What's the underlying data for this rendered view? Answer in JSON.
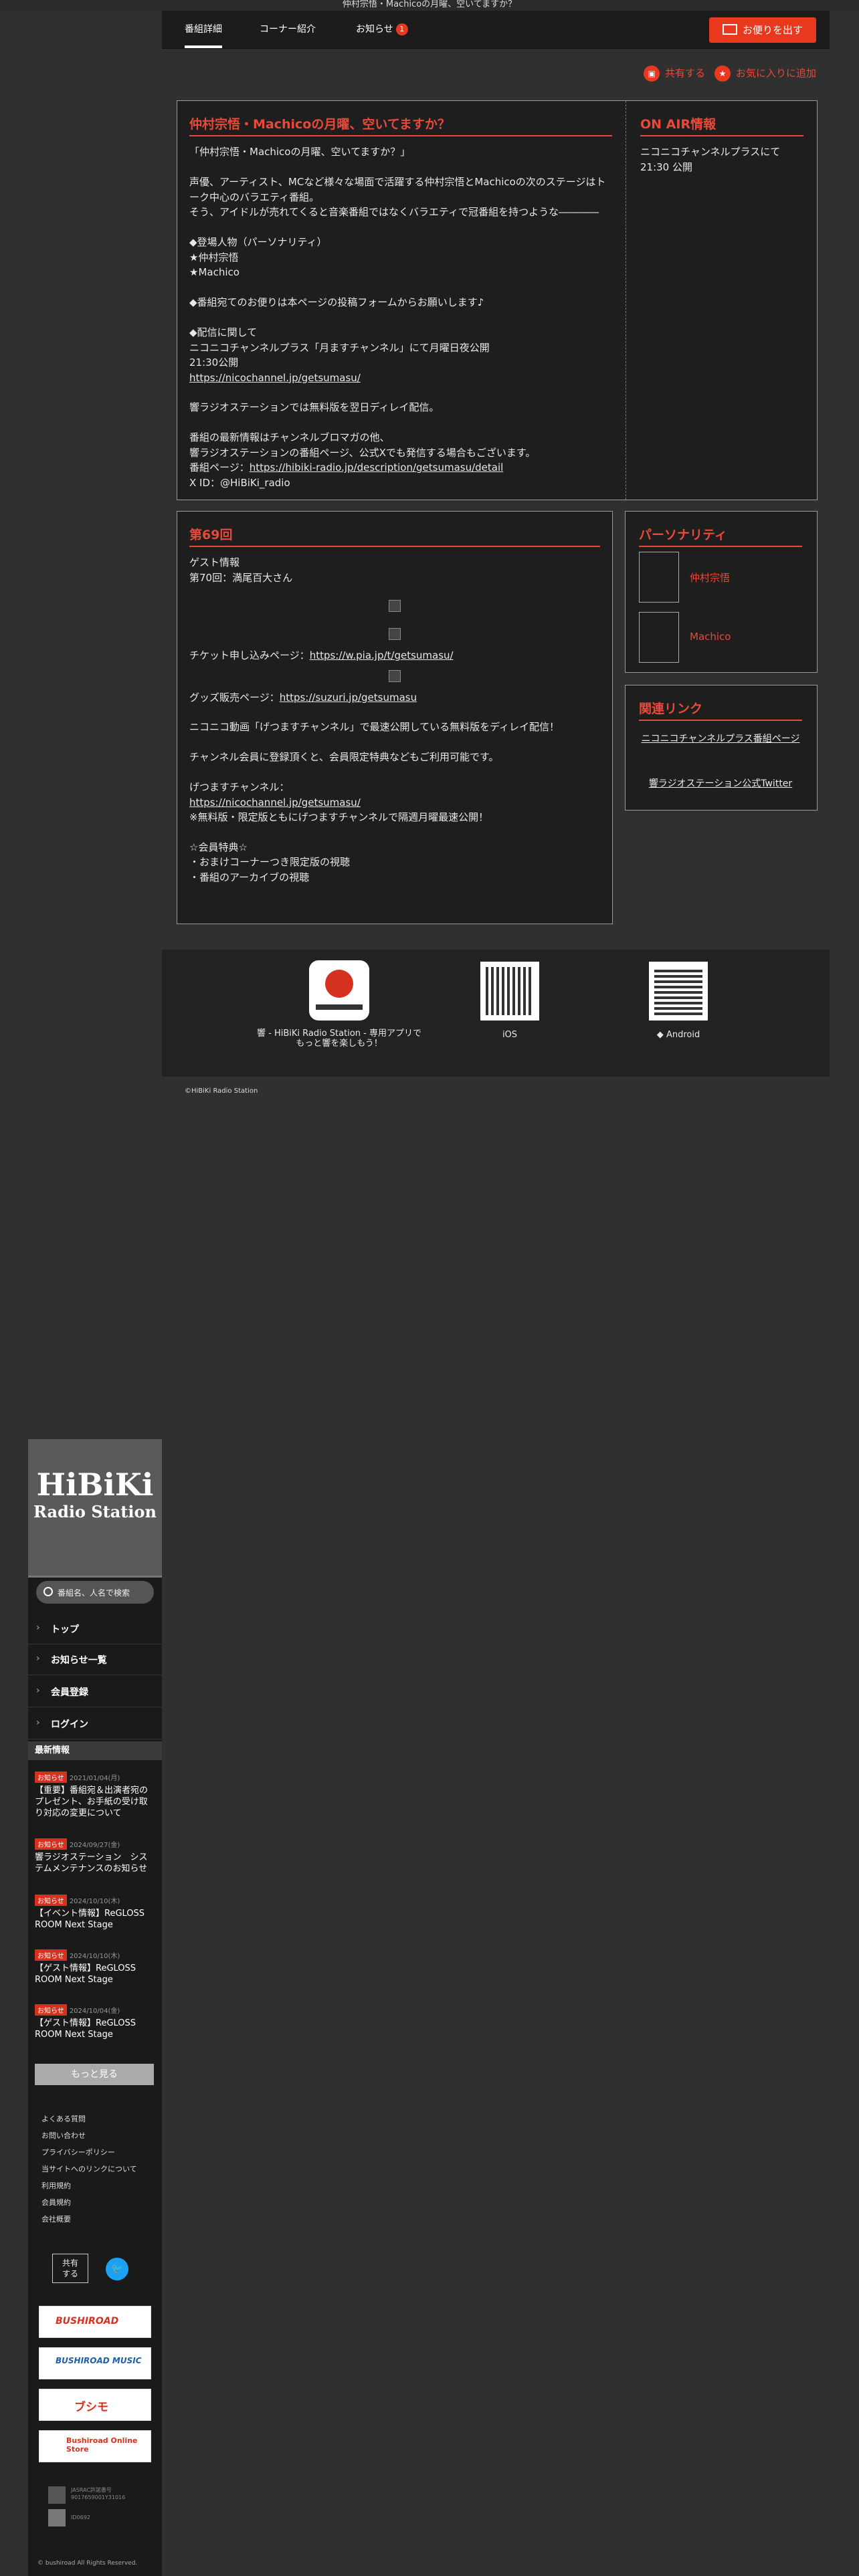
{
  "hero_alt": "仲村宗悟・Machicoの月曜、空いてますか？",
  "tabs": [
    {
      "label": "番組詳細"
    },
    {
      "label": "コーナー紹介"
    },
    {
      "label": "お知らせ",
      "badge": "1"
    }
  ],
  "mail_button": "お便りを出す",
  "share_label": "共有する",
  "favorite_label": "お気に入りに追加",
  "program": {
    "title": "仲村宗悟・Machicoの月曜、空いてますか？",
    "body": "「仲村宗悟・Machicoの月曜、空いてますか？」\n\n声優、アーティスト、MCなど様々な場面で活躍する仲村宗悟とMachicoの次のステージはトーク中心のバラエティ番組。\nそう、アイドルが売れてくると音楽番組ではなくバラエティで冠番組を持つような――――\n\n◆登場人物（パーソナリティ）\n★仲村宗悟\n★Machico\n\n◆番組宛てのお便りは本ページの投稿フォームからお願いします♪\n\n◆配信に関して\nニコニコチャンネルプラス「月ますチャンネル」にて月曜日夜公開\n21:30公開",
    "link1": "https://nicochannel.jp/getsumasu/",
    "body2": "響ラジオステーションでは無料版を翌日ディレイ配信。\n\n番組の最新情報はチャンネルブロマガの他、\n響ラジオステーションの番組ページ、公式Xでも発信する場合もございます。",
    "page_label": "番組ページ：",
    "page_link": "https://hibiki-radio.jp/description/getsumasu/detail",
    "x_id": "X ID：@HiBiKi_radio"
  },
  "on_air": {
    "title": "ON AIR情報",
    "line1": "ニコニコチャンネルプラスにて",
    "line2": "21:30 公開"
  },
  "episode": {
    "title": "第69回",
    "guest": "ゲスト情報\n第70回：満尾百大さん",
    "ticket_label": "チケット申し込みページ：",
    "ticket_link": "https://w.pia.jp/t/getsumasu/",
    "goods_label": "グッズ販売ページ：",
    "goods_link": "https://suzuri.jp/getsumasu",
    "nico_text": "ニコニコ動画「げつますチャンネル」で最速公開している無料版をディレイ配信！\n\nチャンネル会員に登録頂くと、会員限定特典などもご利用可能です。\n\nげつますチャンネル：",
    "nico_link": "https://nicochannel.jp/getsumasu/",
    "note": "※無料版・限定版ともにげつますチャンネルで隔週月曜最速公開！",
    "benefits": "☆会員特典☆\n・おまけコーナーつき限定版の視聴\n・番組のアーカイブの視聴"
  },
  "personality": {
    "title": "パーソナリティ",
    "people": [
      "仲村宗悟",
      "Machico"
    ]
  },
  "related": {
    "title": "関連リンク",
    "links": [
      "ニコニコチャンネルプラス番組ページ",
      "響ラジオステーション公式Twitter"
    ]
  },
  "app": {
    "caption": "響 - HiBiKi Radio Station - 専用アプリで\nもっと響を楽しもう！",
    "ios": " iOS",
    "android": "Android"
  },
  "copyright_main": "©HiBiKi Radio Station",
  "sidebar": {
    "logo_line1": "HiBiKi",
    "logo_line2": "Radio Station",
    "search_placeholder": "番組名、人名で検索",
    "nav": [
      "トップ",
      "お知らせ一覧",
      "会員登録",
      "ログイン"
    ],
    "news_heading": "最新情報",
    "news": [
      {
        "tag": "お知らせ",
        "date": "2021/01/04(月)",
        "title": "【重要】番組宛＆出演者宛のプレゼント、お手紙の受け取り対応の変更について"
      },
      {
        "tag": "お知らせ",
        "date": "2024/09/27(金)",
        "title": "響ラジオステーション　システムメンテナンスのお知らせ"
      },
      {
        "tag": "お知らせ",
        "date": "2024/10/10(木)",
        "title": "【イベント情報】ReGLOSS ROOM Next Stage"
      },
      {
        "tag": "お知らせ",
        "date": "2024/10/10(木)",
        "title": "【ゲスト情報】ReGLOSS ROOM Next Stage"
      },
      {
        "tag": "お知らせ",
        "date": "2024/10/04(金)",
        "title": "【ゲスト情報】ReGLOSS ROOM Next Stage"
      }
    ],
    "more_button": "もっと見る",
    "footer_links": [
      "よくある質問",
      "お問い合わせ",
      "プライバシーポリシー",
      "当サイトへのリンクについて",
      "利用規約",
      "会員規約",
      "会社概要"
    ],
    "share_box": "共有\nする",
    "brands": [
      "BUSHIROAD",
      "BUSHIROAD MUSIC",
      "ブシモ",
      "Bushiroad Online Store"
    ],
    "jasrac": "JASRAC許諾番号\n9017659001Y31016",
    "nextone": "ID0692",
    "copyright": "© bushiroad All Rights Reserved."
  }
}
